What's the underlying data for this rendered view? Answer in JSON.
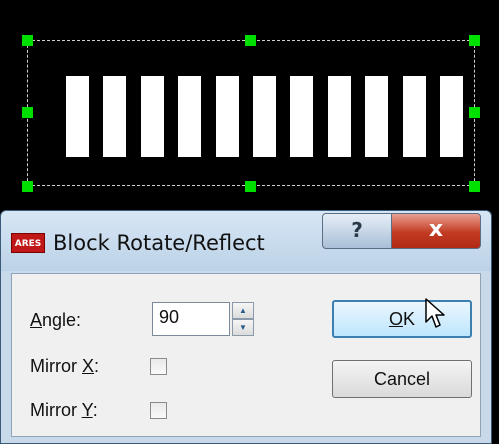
{
  "canvas": {
    "bar_count": 11
  },
  "dialog": {
    "app_icon_text": "ARES",
    "title": "Block Rotate/Reflect",
    "help_glyph": "?",
    "close_glyph": "x",
    "angle": {
      "label_prefix": "",
      "label_underlined": "A",
      "label_rest": "ngle:",
      "value": "90"
    },
    "mirror_x": {
      "label_prefix": "Mirror ",
      "label_underlined": "X",
      "label_rest": ":"
    },
    "mirror_y": {
      "label_prefix": "Mirror ",
      "label_underlined": "Y",
      "label_rest": ":"
    },
    "ok": {
      "underlined": "O",
      "rest": "K"
    },
    "cancel": "Cancel",
    "spin_up": "▲",
    "spin_down": "▼"
  }
}
